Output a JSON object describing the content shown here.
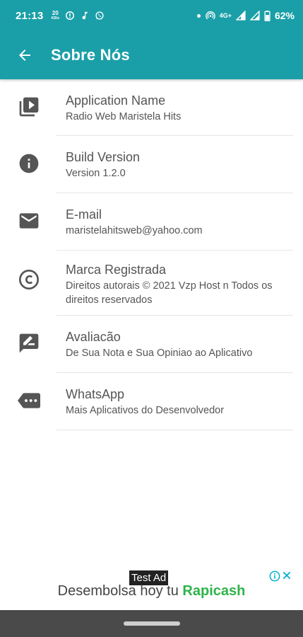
{
  "status_bar": {
    "time": "21:13",
    "speed_value": "20",
    "speed_unit": "KB/s",
    "network_label": "4G+",
    "battery": "62%",
    "left_icons": [
      "speed-indicator-icon",
      "alert-icon",
      "music-note-icon",
      "whatsapp-icon"
    ],
    "right_icons": [
      "dot-icon",
      "hotspot-icon",
      "signal-icon",
      "signal-icon",
      "battery-icon"
    ]
  },
  "app_bar": {
    "title": "Sobre Nós",
    "back_icon": "arrow-back-icon"
  },
  "items": [
    {
      "icon": "video-library-icon",
      "title": "Application Name",
      "subtitle": "Radio Web Maristela Hits"
    },
    {
      "icon": "info-icon",
      "title": "Build Version",
      "subtitle": "Version 1.2.0"
    },
    {
      "icon": "email-icon",
      "title": "E-mail",
      "subtitle": "maristelahitsweb@yahoo.com"
    },
    {
      "icon": "copyright-icon",
      "title": "Marca Registrada",
      "subtitle": "Direitos autorais © 2021 Vzp Host  n Todos os direitos reservados"
    },
    {
      "icon": "rate-review-icon",
      "title": "Avaliacão",
      "subtitle": "De Sua Nota e Sua Opiniao ao Aplicativo"
    },
    {
      "icon": "more-label-icon",
      "title": "WhatsApp",
      "subtitle": "Mais Aplicativos do Desenvolvedor"
    }
  ],
  "ad": {
    "label": "Test Ad",
    "text_prefix": "Desembolsa hoy tu",
    "brand": "Rapicash",
    "brand_color": "#2fb34a"
  },
  "colors": {
    "primary": "#1a9fa8",
    "icon_gray": "#555555",
    "text_gray": "#555555"
  }
}
